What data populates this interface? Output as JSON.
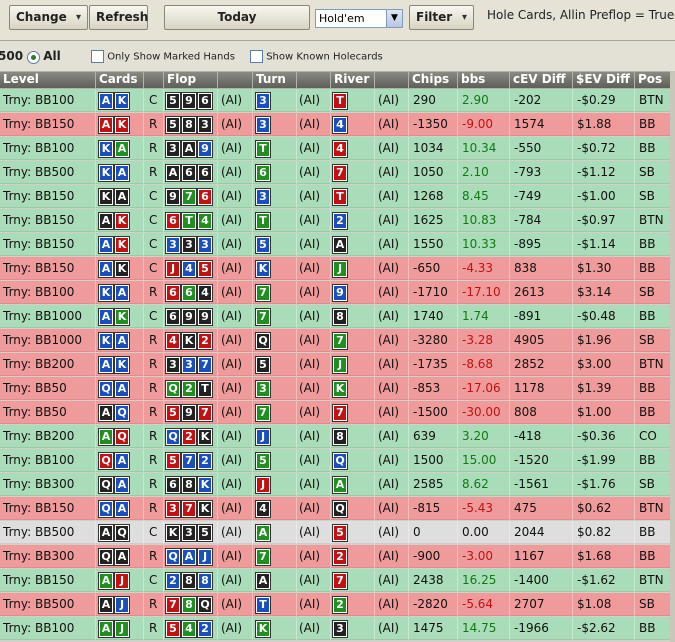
{
  "toolbar": {
    "change_label": "Change",
    "refresh_label": "Refresh",
    "today_label": "Today",
    "game_select": "Hold'em",
    "filter_label": "Filter",
    "status_text": "Hole Cards, Allin Preflop = True"
  },
  "filterbar": {
    "count_fragment": "500",
    "all_label": "All",
    "marked_label": "Only Show Marked Hands",
    "known_label": "Show Known Holecards"
  },
  "columns": [
    "Level",
    "Cards",
    "",
    "Flop",
    "",
    "Turn",
    "",
    "River",
    "",
    "Chips",
    "bbs",
    "cEV Diff",
    "$EV Diff",
    "Pos"
  ],
  "suit_colors": {
    "s": "#222222",
    "h": "#c41010",
    "d": "#1a4fbf",
    "c": "#1f8f1f"
  },
  "row_colors": {
    "g": "#a9dcb8",
    "r": "#f09b9b",
    "n": "#dedede"
  },
  "rows": [
    {
      "level": "Trny: BB100",
      "cards": [
        [
          "A",
          "d"
        ],
        [
          "K",
          "d"
        ]
      ],
      "act": "C",
      "flop": [
        [
          "5",
          "s"
        ],
        [
          "9",
          "s"
        ],
        [
          "6",
          "s"
        ]
      ],
      "turn": [
        "3",
        "d"
      ],
      "river": [
        "T",
        "h"
      ],
      "chips": "290",
      "bbs": "2.90",
      "cev": "-202",
      "dev": "-$0.29",
      "pos": "BTN",
      "bg": "g"
    },
    {
      "level": "Trny: BB150",
      "cards": [
        [
          "A",
          "h"
        ],
        [
          "K",
          "h"
        ]
      ],
      "act": "R",
      "flop": [
        [
          "5",
          "s"
        ],
        [
          "8",
          "s"
        ],
        [
          "3",
          "s"
        ]
      ],
      "turn": [
        "3",
        "d"
      ],
      "river": [
        "4",
        "d"
      ],
      "chips": "-1350",
      "bbs": "-9.00",
      "cev": "1574",
      "dev": "$1.88",
      "pos": "BB",
      "bg": "r"
    },
    {
      "level": "Trny: BB100",
      "cards": [
        [
          "K",
          "d"
        ],
        [
          "A",
          "c"
        ]
      ],
      "act": "R",
      "flop": [
        [
          "3",
          "s"
        ],
        [
          "A",
          "s"
        ],
        [
          "9",
          "d"
        ]
      ],
      "turn": [
        "T",
        "c"
      ],
      "river": [
        "4",
        "h"
      ],
      "chips": "1034",
      "bbs": "10.34",
      "cev": "-550",
      "dev": "-$0.72",
      "pos": "BB",
      "bg": "g"
    },
    {
      "level": "Trny: BB500",
      "cards": [
        [
          "K",
          "d"
        ],
        [
          "A",
          "d"
        ]
      ],
      "act": "R",
      "flop": [
        [
          "A",
          "s"
        ],
        [
          "6",
          "s"
        ],
        [
          "6",
          "s"
        ]
      ],
      "turn": [
        "6",
        "c"
      ],
      "river": [
        "7",
        "h"
      ],
      "chips": "1050",
      "bbs": "2.10",
      "cev": "-793",
      "dev": "-$1.12",
      "pos": "SB",
      "bg": "g"
    },
    {
      "level": "Trny: BB150",
      "cards": [
        [
          "K",
          "s"
        ],
        [
          "A",
          "s"
        ]
      ],
      "act": "C",
      "flop": [
        [
          "9",
          "s"
        ],
        [
          "7",
          "c"
        ],
        [
          "6",
          "h"
        ]
      ],
      "turn": [
        "3",
        "d"
      ],
      "river": [
        "T",
        "h"
      ],
      "chips": "1268",
      "bbs": "8.45",
      "cev": "-749",
      "dev": "-$1.00",
      "pos": "SB",
      "bg": "g"
    },
    {
      "level": "Trny: BB150",
      "cards": [
        [
          "A",
          "s"
        ],
        [
          "K",
          "h"
        ]
      ],
      "act": "C",
      "flop": [
        [
          "6",
          "h"
        ],
        [
          "T",
          "c"
        ],
        [
          "4",
          "c"
        ]
      ],
      "turn": [
        "T",
        "c"
      ],
      "river": [
        "2",
        "d"
      ],
      "chips": "1625",
      "bbs": "10.83",
      "cev": "-784",
      "dev": "-$0.97",
      "pos": "BTN",
      "bg": "g"
    },
    {
      "level": "Trny: BB150",
      "cards": [
        [
          "A",
          "d"
        ],
        [
          "K",
          "h"
        ]
      ],
      "act": "C",
      "flop": [
        [
          "3",
          "d"
        ],
        [
          "3",
          "s"
        ],
        [
          "3",
          "d"
        ]
      ],
      "turn": [
        "5",
        "d"
      ],
      "river": [
        "A",
        "s"
      ],
      "chips": "1550",
      "bbs": "10.33",
      "cev": "-895",
      "dev": "-$1.14",
      "pos": "BB",
      "bg": "g"
    },
    {
      "level": "Trny: BB150",
      "cards": [
        [
          "A",
          "d"
        ],
        [
          "K",
          "s"
        ]
      ],
      "act": "C",
      "flop": [
        [
          "J",
          "h"
        ],
        [
          "4",
          "d"
        ],
        [
          "5",
          "h"
        ]
      ],
      "turn": [
        "K",
        "d"
      ],
      "river": [
        "J",
        "c"
      ],
      "chips": "-650",
      "bbs": "-4.33",
      "cev": "838",
      "dev": "$1.30",
      "pos": "BB",
      "bg": "r"
    },
    {
      "level": "Trny: BB100",
      "cards": [
        [
          "K",
          "d"
        ],
        [
          "A",
          "d"
        ]
      ],
      "act": "R",
      "flop": [
        [
          "6",
          "h"
        ],
        [
          "6",
          "c"
        ],
        [
          "4",
          "s"
        ]
      ],
      "turn": [
        "7",
        "c"
      ],
      "river": [
        "9",
        "d"
      ],
      "chips": "-1710",
      "bbs": "-17.10",
      "cev": "2613",
      "dev": "$3.14",
      "pos": "SB",
      "bg": "r"
    },
    {
      "level": "Trny: BB1000",
      "cards": [
        [
          "A",
          "d"
        ],
        [
          "K",
          "c"
        ]
      ],
      "act": "C",
      "flop": [
        [
          "6",
          "s"
        ],
        [
          "9",
          "s"
        ],
        [
          "9",
          "s"
        ]
      ],
      "turn": [
        "7",
        "c"
      ],
      "river": [
        "8",
        "s"
      ],
      "chips": "1740",
      "bbs": "1.74",
      "cev": "-891",
      "dev": "-$0.48",
      "pos": "BB",
      "bg": "g"
    },
    {
      "level": "Trny: BB1000",
      "cards": [
        [
          "K",
          "d"
        ],
        [
          "A",
          "d"
        ]
      ],
      "act": "R",
      "flop": [
        [
          "4",
          "h"
        ],
        [
          "K",
          "s"
        ],
        [
          "2",
          "h"
        ]
      ],
      "turn": [
        "Q",
        "s"
      ],
      "river": [
        "7",
        "c"
      ],
      "chips": "-3280",
      "bbs": "-3.28",
      "cev": "4905",
      "dev": "$1.96",
      "pos": "SB",
      "bg": "r"
    },
    {
      "level": "Trny: BB200",
      "cards": [
        [
          "A",
          "d"
        ],
        [
          "K",
          "d"
        ]
      ],
      "act": "R",
      "flop": [
        [
          "3",
          "s"
        ],
        [
          "3",
          "d"
        ],
        [
          "7",
          "d"
        ]
      ],
      "turn": [
        "5",
        "s"
      ],
      "river": [
        "J",
        "c"
      ],
      "chips": "-1735",
      "bbs": "-8.68",
      "cev": "2852",
      "dev": "$3.00",
      "pos": "BTN",
      "bg": "r"
    },
    {
      "level": "Trny: BB50",
      "cards": [
        [
          "Q",
          "d"
        ],
        [
          "A",
          "d"
        ]
      ],
      "act": "R",
      "flop": [
        [
          "Q",
          "c"
        ],
        [
          "2",
          "c"
        ],
        [
          "T",
          "s"
        ]
      ],
      "turn": [
        "3",
        "c"
      ],
      "river": [
        "K",
        "c"
      ],
      "chips": "-853",
      "bbs": "-17.06",
      "cev": "1178",
      "dev": "$1.39",
      "pos": "BB",
      "bg": "r"
    },
    {
      "level": "Trny: BB50",
      "cards": [
        [
          "A",
          "s"
        ],
        [
          "Q",
          "d"
        ]
      ],
      "act": "R",
      "flop": [
        [
          "5",
          "h"
        ],
        [
          "9",
          "s"
        ],
        [
          "7",
          "h"
        ]
      ],
      "turn": [
        "7",
        "c"
      ],
      "river": [
        "7",
        "h"
      ],
      "chips": "-1500",
      "bbs": "-30.00",
      "cev": "808",
      "dev": "$1.00",
      "pos": "BB",
      "bg": "r"
    },
    {
      "level": "Trny: BB200",
      "cards": [
        [
          "A",
          "c"
        ],
        [
          "Q",
          "h"
        ]
      ],
      "act": "R",
      "flop": [
        [
          "Q",
          "d"
        ],
        [
          "2",
          "h"
        ],
        [
          "K",
          "s"
        ]
      ],
      "turn": [
        "J",
        "d"
      ],
      "river": [
        "8",
        "s"
      ],
      "chips": "639",
      "bbs": "3.20",
      "cev": "-418",
      "dev": "-$0.36",
      "pos": "CO",
      "bg": "g"
    },
    {
      "level": "Trny: BB100",
      "cards": [
        [
          "Q",
          "h"
        ],
        [
          "A",
          "d"
        ]
      ],
      "act": "R",
      "flop": [
        [
          "5",
          "h"
        ],
        [
          "7",
          "d"
        ],
        [
          "2",
          "d"
        ]
      ],
      "turn": [
        "5",
        "c"
      ],
      "river": [
        "Q",
        "d"
      ],
      "chips": "1500",
      "bbs": "15.00",
      "cev": "-1520",
      "dev": "-$1.99",
      "pos": "BB",
      "bg": "g"
    },
    {
      "level": "Trny: BB300",
      "cards": [
        [
          "Q",
          "s"
        ],
        [
          "A",
          "d"
        ]
      ],
      "act": "R",
      "flop": [
        [
          "6",
          "s"
        ],
        [
          "8",
          "s"
        ],
        [
          "K",
          "d"
        ]
      ],
      "turn": [
        "J",
        "h"
      ],
      "river": [
        "A",
        "c"
      ],
      "chips": "2585",
      "bbs": "8.62",
      "cev": "-1561",
      "dev": "-$1.76",
      "pos": "SB",
      "bg": "g"
    },
    {
      "level": "Trny: BB150",
      "cards": [
        [
          "Q",
          "d"
        ],
        [
          "A",
          "d"
        ]
      ],
      "act": "R",
      "flop": [
        [
          "3",
          "h"
        ],
        [
          "7",
          "h"
        ],
        [
          "K",
          "s"
        ]
      ],
      "turn": [
        "4",
        "s"
      ],
      "river": [
        "Q",
        "s"
      ],
      "chips": "-815",
      "bbs": "-5.43",
      "cev": "475",
      "dev": "$0.62",
      "pos": "BTN",
      "bg": "r"
    },
    {
      "level": "Trny: BB500",
      "cards": [
        [
          "A",
          "s"
        ],
        [
          "Q",
          "s"
        ]
      ],
      "act": "C",
      "flop": [
        [
          "K",
          "s"
        ],
        [
          "3",
          "s"
        ],
        [
          "5",
          "s"
        ]
      ],
      "turn": [
        "A",
        "c"
      ],
      "river": [
        "5",
        "h"
      ],
      "chips": "0",
      "bbs": "0.00",
      "cev": "2044",
      "dev": "$0.82",
      "pos": "BB",
      "bg": "n"
    },
    {
      "level": "Trny: BB300",
      "cards": [
        [
          "Q",
          "s"
        ],
        [
          "A",
          "s"
        ]
      ],
      "act": "R",
      "flop": [
        [
          "Q",
          "d"
        ],
        [
          "A",
          "d"
        ],
        [
          "J",
          "d"
        ]
      ],
      "turn": [
        "7",
        "c"
      ],
      "river": [
        "2",
        "h"
      ],
      "chips": "-900",
      "bbs": "-3.00",
      "cev": "1167",
      "dev": "$1.68",
      "pos": "BB",
      "bg": "r"
    },
    {
      "level": "Trny: BB150",
      "cards": [
        [
          "A",
          "c"
        ],
        [
          "J",
          "h"
        ]
      ],
      "act": "C",
      "flop": [
        [
          "2",
          "d"
        ],
        [
          "8",
          "s"
        ],
        [
          "8",
          "d"
        ]
      ],
      "turn": [
        "A",
        "s"
      ],
      "river": [
        "7",
        "h"
      ],
      "chips": "2438",
      "bbs": "16.25",
      "cev": "-1400",
      "dev": "-$1.62",
      "pos": "BTN",
      "bg": "g"
    },
    {
      "level": "Trny: BB500",
      "cards": [
        [
          "A",
          "s"
        ],
        [
          "J",
          "d"
        ]
      ],
      "act": "R",
      "flop": [
        [
          "7",
          "h"
        ],
        [
          "8",
          "c"
        ],
        [
          "Q",
          "s"
        ]
      ],
      "turn": [
        "T",
        "d"
      ],
      "river": [
        "2",
        "c"
      ],
      "chips": "-2820",
      "bbs": "-5.64",
      "cev": "2707",
      "dev": "$1.08",
      "pos": "SB",
      "bg": "r"
    },
    {
      "level": "Trny: BB100",
      "cards": [
        [
          "A",
          "c"
        ],
        [
          "J",
          "c"
        ]
      ],
      "act": "R",
      "flop": [
        [
          "5",
          "h"
        ],
        [
          "4",
          "c"
        ],
        [
          "2",
          "d"
        ]
      ],
      "turn": [
        "K",
        "c"
      ],
      "river": [
        "3",
        "s"
      ],
      "chips": "1475",
      "bbs": "14.75",
      "cev": "-1966",
      "dev": "-$2.62",
      "pos": "BB",
      "bg": "g"
    }
  ],
  "ai_label": "(AI)"
}
